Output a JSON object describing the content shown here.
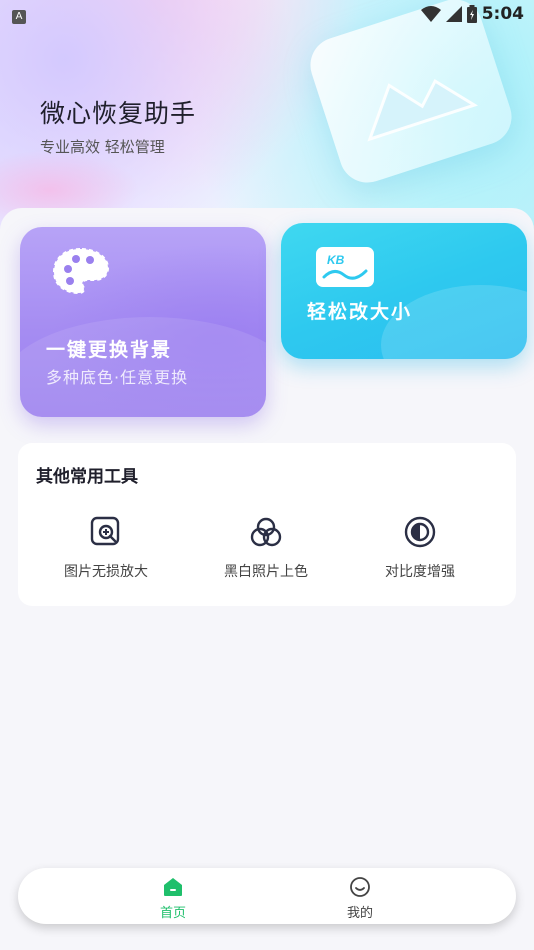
{
  "status_bar": {
    "left_badge": "A",
    "time": "5:04",
    "icons": [
      "wifi-icon",
      "signal-icon",
      "battery-icon"
    ]
  },
  "header": {
    "title": "微心恢复助手",
    "subtitle": "专业高效  轻松管理"
  },
  "cards": {
    "background_swap": {
      "title": "一键更换背景",
      "description": "多种底色·任意更换",
      "icon": "palette-icon"
    },
    "resize": {
      "title": "轻松改大小",
      "icon": "kb-icon",
      "icon_text": "KB"
    }
  },
  "tools": {
    "heading": "其他常用工具",
    "items": [
      {
        "label": "图片无损放大",
        "icon": "image-zoom-icon"
      },
      {
        "label": "黑白照片上色",
        "icon": "color-circles-icon"
      },
      {
        "label": "对比度增强",
        "icon": "contrast-icon"
      }
    ]
  },
  "bottom_nav": {
    "items": [
      {
        "label": "首页",
        "icon": "home-icon",
        "active": true
      },
      {
        "label": "我的",
        "icon": "profile-icon",
        "active": false
      }
    ]
  },
  "colors": {
    "accent_green": "#1fbf6b",
    "card_purple": "#a58cf2",
    "card_cyan": "#2ec9ef"
  }
}
